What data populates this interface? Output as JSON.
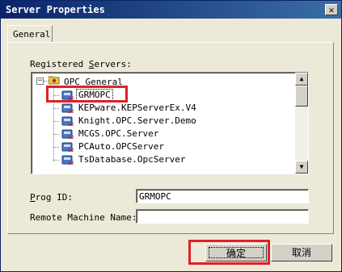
{
  "window": {
    "title": "Server Properties",
    "close_glyph": "✕"
  },
  "tabs": [
    {
      "label": "General"
    }
  ],
  "servers": {
    "label_prefix": "Registered ",
    "label_accel": "S",
    "label_suffix": "ervers:",
    "root": {
      "label": "OPC General",
      "expander": "−"
    },
    "items": [
      {
        "label": "GRMOPC",
        "selected": true,
        "icon_badge": "32"
      },
      {
        "label": "KEPware.KEPServerEx.V4",
        "icon_badge": "32"
      },
      {
        "label": "Knight.OPC.Server.Demo",
        "icon_badge": "32"
      },
      {
        "label": "MCGS.OPC.Server",
        "icon_badge": "32"
      },
      {
        "label": "PCAuto.OPCServer",
        "icon_badge": "32"
      },
      {
        "label": "TsDatabase.OpcServer",
        "icon_badge": "32"
      }
    ],
    "scroll_up": "▲",
    "scroll_down": "▼"
  },
  "prog_id": {
    "label_accel": "P",
    "label_rest": "rog ID:",
    "value": "GRMOPC"
  },
  "remote_machine": {
    "label": "Remote Machine Name:",
    "value": ""
  },
  "buttons": {
    "ok": "确定",
    "cancel": "取消"
  },
  "colors": {
    "highlight_box": "#e0202a",
    "title_bar": "#0a246a",
    "dialog_bg": "#ece9d8"
  }
}
